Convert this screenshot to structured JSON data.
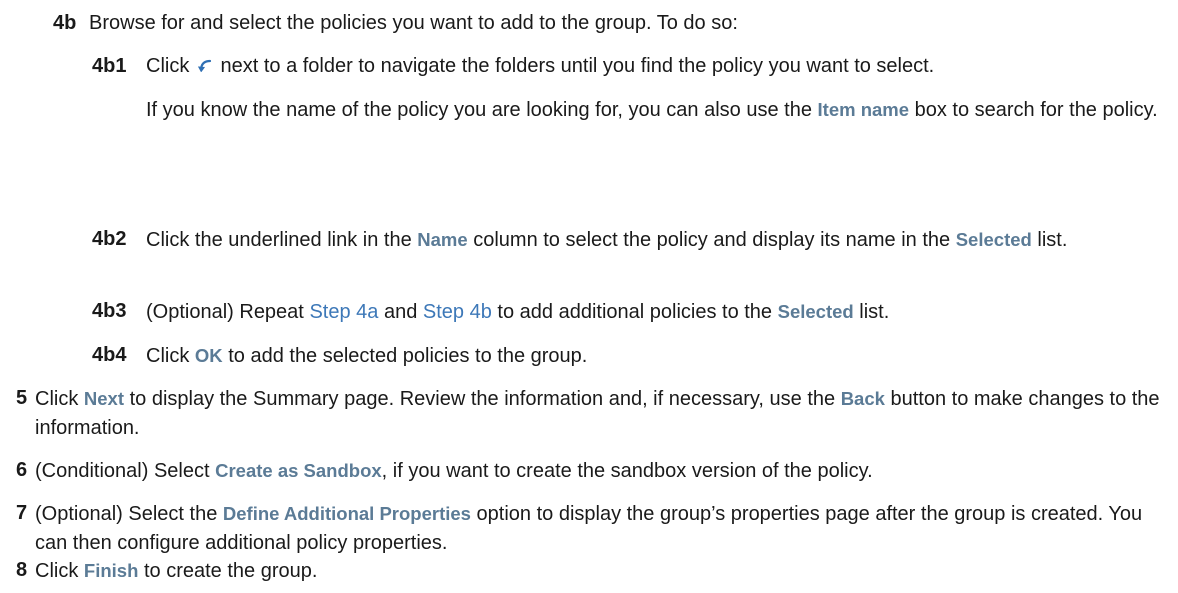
{
  "steps": {
    "s4b": {
      "num": "4b",
      "text": "Browse for and select the policies you want to add to the group. To do so:"
    },
    "s4b1": {
      "num": "4b1",
      "pre": "Click",
      "icon": "navigate-arrow-icon",
      "post": "next to a folder to navigate the folders until you find the policy you want to select.",
      "p2_pre": "If you know the name of the policy you are looking for, you can also use the",
      "p2_ui": "Item name",
      "p2_post": "box to search for the policy."
    },
    "s4b2": {
      "num": "4b2",
      "pre": "Click the underlined link in the",
      "ui1": "Name",
      "mid": "column to select the policy and display its name in the",
      "ui2": "Selected",
      "post": "list."
    },
    "s4b3": {
      "num": "4b3",
      "pre": "(Optional) Repeat",
      "link1": "Step 4a",
      "mid": "and",
      "link2": "Step 4b",
      "mid2": "to add additional policies to the",
      "ui": "Selected",
      "post": "list."
    },
    "s4b4": {
      "num": "4b4",
      "pre": "Click",
      "ui": "OK",
      "post": "to add the selected policies to the group."
    },
    "s5": {
      "num": "5",
      "pre": "Click",
      "ui1": "Next",
      "mid": "to display the Summary page. Review the information and, if necessary, use the",
      "ui2": "Back",
      "post": "button to make changes to the information."
    },
    "s6": {
      "num": "6",
      "pre": "(Conditional) Select",
      "ui": "Create as Sandbox",
      "post": ", if you want to create the sandbox version of the policy."
    },
    "s7": {
      "num": "7",
      "pre": "(Optional) Select the",
      "ui": "Define Additional Properties",
      "post": "option to display the group’s properties page after the group is created. You can then configure additional policy properties."
    },
    "s8": {
      "num": "8",
      "pre": "Click",
      "ui": "Finish",
      "post": "to create the group."
    }
  },
  "colors": {
    "text": "#1a1a1a",
    "ui_label": "#5b7b96",
    "link": "#3d78b8",
    "icon": "#2f6fb3"
  }
}
